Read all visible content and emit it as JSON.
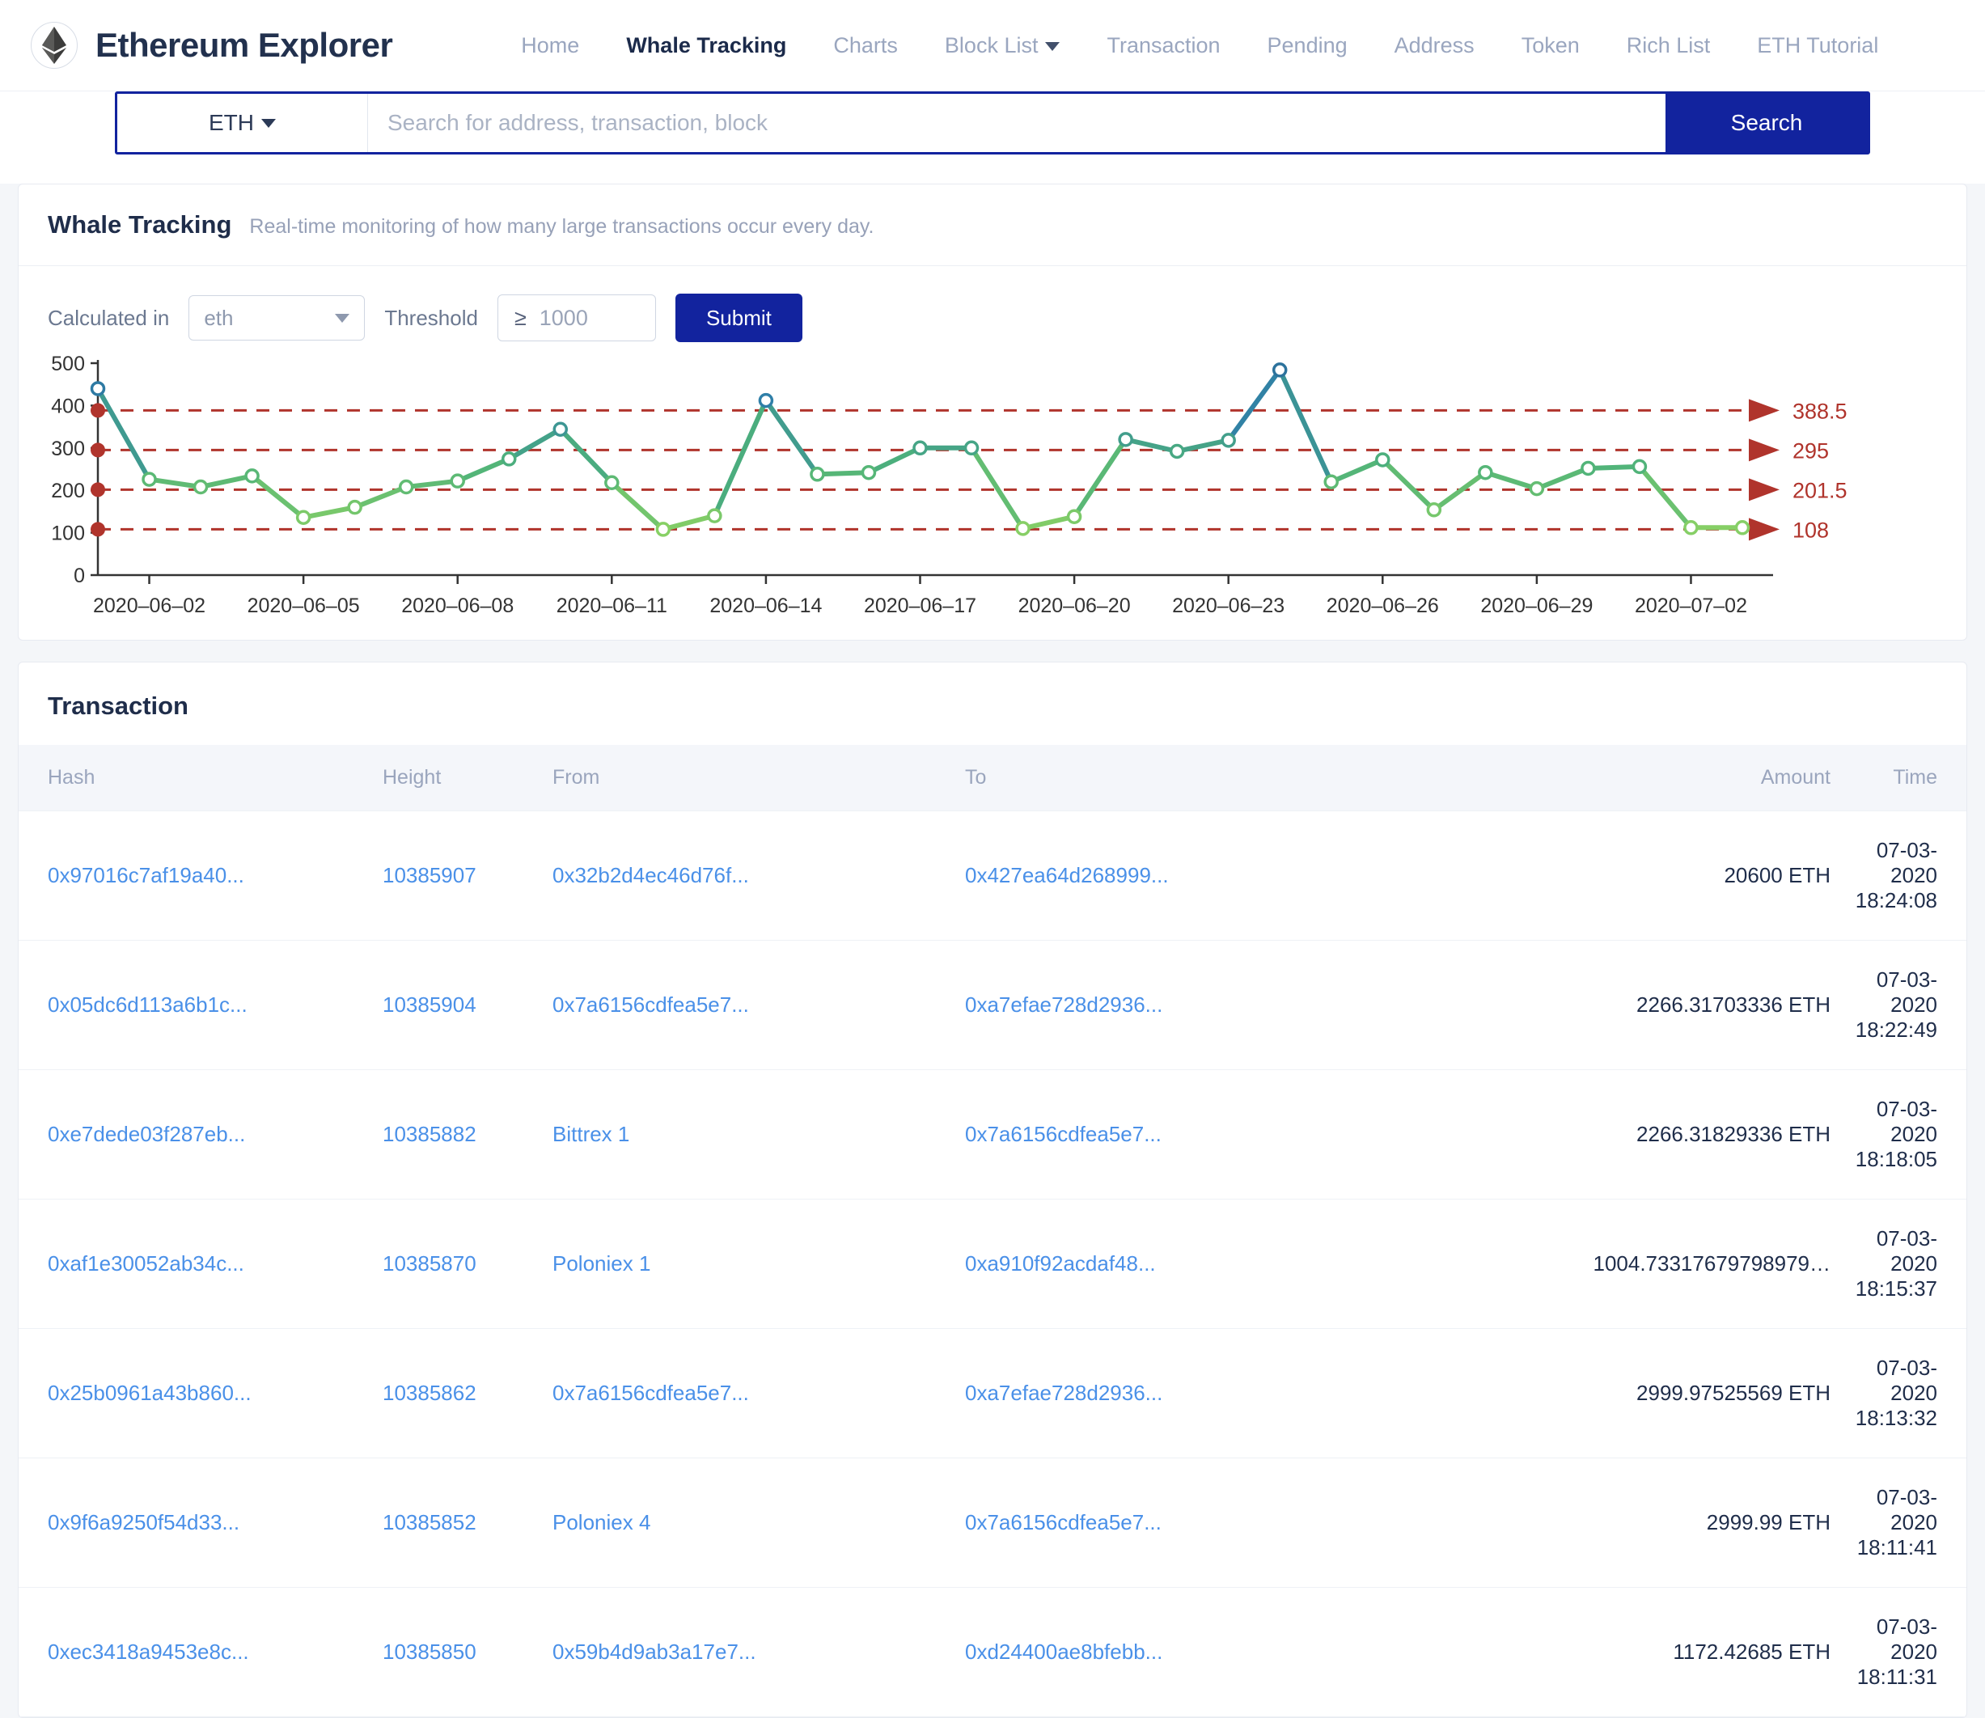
{
  "header": {
    "brand": "Ethereum Explorer",
    "logo_icon": "ethereum-diamond-icon",
    "nav": [
      {
        "label": "Home",
        "active": false,
        "dropdown": false
      },
      {
        "label": "Whale Tracking",
        "active": true,
        "dropdown": false
      },
      {
        "label": "Charts",
        "active": false,
        "dropdown": false
      },
      {
        "label": "Block List",
        "active": false,
        "dropdown": true
      },
      {
        "label": "Transaction",
        "active": false,
        "dropdown": false
      },
      {
        "label": "Pending",
        "active": false,
        "dropdown": false
      },
      {
        "label": "Address",
        "active": false,
        "dropdown": false
      },
      {
        "label": "Token",
        "active": false,
        "dropdown": false
      },
      {
        "label": "Rich List",
        "active": false,
        "dropdown": false
      },
      {
        "label": "ETH Tutorial",
        "active": false,
        "dropdown": false
      }
    ]
  },
  "search": {
    "coin": "ETH",
    "placeholder": "Search for address, transaction, block",
    "value": "",
    "button": "Search"
  },
  "whale": {
    "title": "Whale Tracking",
    "subtitle": "Real-time monitoring of how many large transactions occur every day.",
    "calculated_in_label": "Calculated in",
    "unit_value": "eth",
    "threshold_label": "Threshold",
    "threshold_operator": "≥",
    "threshold_value": "1000",
    "submit": "Submit"
  },
  "chart_data": {
    "type": "line",
    "title": "",
    "xlabel": "",
    "ylabel": "",
    "ylim": [
      0,
      500
    ],
    "yticks": [
      0,
      100,
      200,
      300,
      400,
      500
    ],
    "grid": false,
    "legend": "none",
    "x": [
      "2020-06-01",
      "2020-06-02",
      "2020-06-03",
      "2020-06-04",
      "2020-06-05",
      "2020-06-06",
      "2020-06-07",
      "2020-06-08",
      "2020-06-09",
      "2020-06-10",
      "2020-06-11",
      "2020-06-12",
      "2020-06-13",
      "2020-06-14",
      "2020-06-15",
      "2020-06-16",
      "2020-06-17",
      "2020-06-18",
      "2020-06-19",
      "2020-06-20",
      "2020-06-21",
      "2020-06-22",
      "2020-06-23",
      "2020-06-24",
      "2020-06-25",
      "2020-06-26",
      "2020-06-27",
      "2020-06-28",
      "2020-06-29",
      "2020-06-30",
      "2020-07-01",
      "2020-07-02",
      "2020-07-03"
    ],
    "xtick_labels": [
      "2020–06–02",
      "2020–06–05",
      "2020–06–08",
      "2020–06–11",
      "2020–06–14",
      "2020–06–17",
      "2020–06–20",
      "2020–06–23",
      "2020–06–26",
      "2020–06–29",
      "2020–07–02"
    ],
    "values": [
      440,
      226,
      208,
      234,
      136,
      160,
      208,
      222,
      274,
      344,
      218,
      108,
      140,
      412,
      238,
      242,
      300,
      300,
      110,
      138,
      320,
      292,
      318,
      484,
      220,
      272,
      154,
      242,
      204,
      252,
      256,
      112,
      112
    ],
    "reference_lines": [
      {
        "value": 388.5,
        "label": "388.5"
      },
      {
        "value": 295,
        "label": "295"
      },
      {
        "value": 201.5,
        "label": "201.5"
      },
      {
        "value": 108,
        "label": "108"
      }
    ],
    "reference_color": "#b0342c",
    "line_gradient": [
      "#8ed363",
      "#4eb27a",
      "#2f7fa8",
      "#2b6f9a"
    ]
  },
  "transactions": {
    "title": "Transaction",
    "columns": [
      "Hash",
      "Height",
      "From",
      "To",
      "Amount",
      "Time"
    ],
    "rows": [
      {
        "hash": "0x97016c7af19a40...",
        "height": "10385907",
        "from": "0x32b2d4ec46d76f...",
        "to": "0x427ea64d268999...",
        "amount": "20600 ETH",
        "time": "07-03-2020 18:24:08"
      },
      {
        "hash": "0x05dc6d113a6b1c...",
        "height": "10385904",
        "from": "0x7a6156cdfea5e7...",
        "to": "0xa7efae728d2936...",
        "amount": "2266.31703336 ETH",
        "time": "07-03-2020 18:22:49"
      },
      {
        "hash": "0xe7dede03f287eb...",
        "height": "10385882",
        "from": "Bittrex 1",
        "to": "0x7a6156cdfea5e7...",
        "amount": "2266.31829336 ETH",
        "time": "07-03-2020 18:18:05"
      },
      {
        "hash": "0xaf1e30052ab34c...",
        "height": "10385870",
        "from": "Poloniex 1",
        "to": "0xa910f92acdaf48...",
        "amount": "1004.73317679798979…",
        "time": "07-03-2020 18:15:37"
      },
      {
        "hash": "0x25b0961a43b860...",
        "height": "10385862",
        "from": "0x7a6156cdfea5e7...",
        "to": "0xa7efae728d2936...",
        "amount": "2999.97525569 ETH",
        "time": "07-03-2020 18:13:32"
      },
      {
        "hash": "0x9f6a9250f54d33...",
        "height": "10385852",
        "from": "Poloniex 4",
        "to": "0x7a6156cdfea5e7...",
        "amount": "2999.99 ETH",
        "time": "07-03-2020 18:11:41"
      },
      {
        "hash": "0xec3418a9453e8c...",
        "height": "10385850",
        "from": "0x59b4d9ab3a17e7...",
        "to": "0xd24400ae8bfebb...",
        "amount": "1172.42685 ETH",
        "time": "07-03-2020 18:11:31"
      }
    ]
  }
}
